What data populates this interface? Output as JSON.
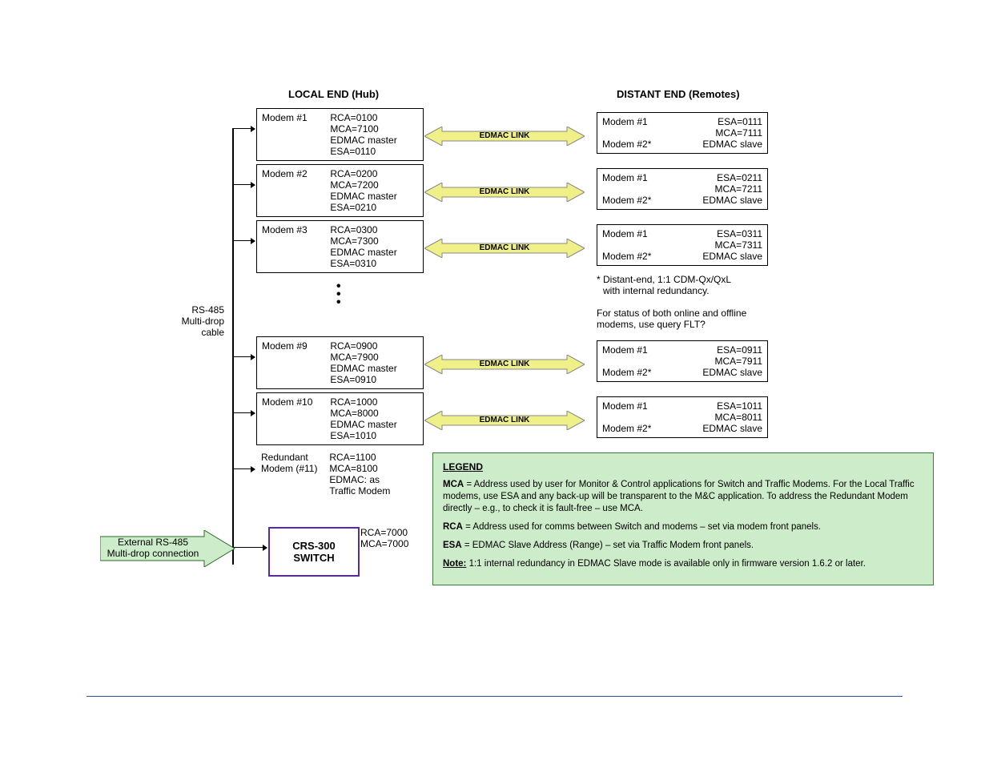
{
  "headers": {
    "local": "LOCAL END (Hub)",
    "distant": "DISTANT END (Remotes)"
  },
  "rs485_label": "RS-485\nMulti-drop\ncable",
  "local_modems": [
    {
      "name": "Modem #1",
      "rca": "RCA=0100",
      "mca": "MCA=7100",
      "mode": "EDMAC master",
      "esa": "ESA=0110"
    },
    {
      "name": "Modem #2",
      "rca": "RCA=0200",
      "mca": "MCA=7200",
      "mode": "EDMAC master",
      "esa": "ESA=0210"
    },
    {
      "name": "Modem #3",
      "rca": "RCA=0300",
      "mca": "MCA=7300",
      "mode": "EDMAC master",
      "esa": "ESA=0310"
    },
    {
      "name": "Modem #9",
      "rca": "RCA=0900",
      "mca": "MCA=7900",
      "mode": "EDMAC master",
      "esa": "ESA=0910"
    },
    {
      "name": "Modem #10",
      "rca": "RCA=1000",
      "mca": "MCA=8000",
      "mode": "EDMAC master",
      "esa": "ESA=1010"
    }
  ],
  "redundant_modem": {
    "name": "Redundant\nModem (#11)",
    "rca": "RCA=1100",
    "mca": "MCA=8100",
    "mode": "EDMAC: as\nTraffic Modem"
  },
  "switch": {
    "name": "CRS-300\nSWITCH",
    "rca": "RCA=7000",
    "mca": "MCA=7000"
  },
  "ext_conn": "External RS-485\nMulti-drop connection",
  "link_label": "EDMAC LINK",
  "remotes": [
    {
      "m1": "Modem #1",
      "esa": "ESA=0111",
      "mca": "MCA=7111",
      "m2": "Modem #2*",
      "mode": "EDMAC slave"
    },
    {
      "m1": "Modem #1",
      "esa": "ESA=0211",
      "mca": "MCA=7211",
      "m2": "Modem #2*",
      "mode": "EDMAC slave"
    },
    {
      "m1": "Modem #1",
      "esa": "ESA=0311",
      "mca": "MCA=7311",
      "m2": "Modem #2*",
      "mode": "EDMAC slave"
    },
    {
      "m1": "Modem #1",
      "esa": "ESA=0911",
      "mca": "MCA=7911",
      "m2": "Modem #2*",
      "mode": "EDMAC slave"
    },
    {
      "m1": "Modem #1",
      "esa": "ESA=1011",
      "mca": "MCA=8011",
      "m2": "Modem #2*",
      "mode": "EDMAC slave"
    }
  ],
  "mid_note": {
    "l1": "* Distant-end, 1:1 CDM-Qx/QxL",
    "l2": "  with internal redundancy.",
    "l3": "For status of both online and offline",
    "l4": "modems, use query FLT?"
  },
  "legend": {
    "title": "LEGEND",
    "mca_k": "MCA",
    "mca": " = Address used by user for Monitor & Control applications for Switch and Traffic Modems. For the Local Traffic modems, use ESA and any back-up will be transparent to the M&C application. To address the Redundant Modem directly – e.g., to check it is fault-free – use MCA.",
    "rca_k": "RCA",
    "rca": " = Address used for comms between Switch and modems – set via modem front panels.",
    "esa_k": "ESA",
    "esa": " = EDMAC Slave Address (Range) – set via Traffic Modem front panels.",
    "note_k": "Note:",
    "note": " 1:1 internal redundancy in EDMAC Slave mode is available only in firmware version 1.6.2 or later."
  }
}
